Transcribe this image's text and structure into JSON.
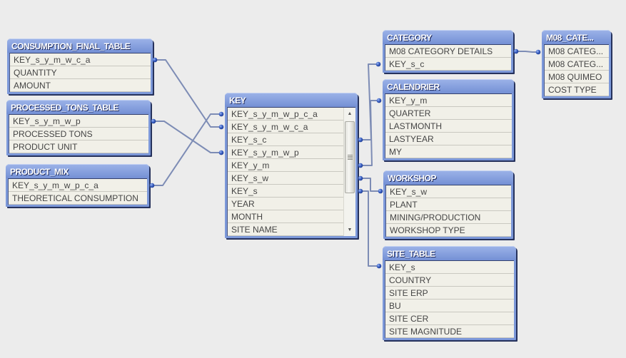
{
  "view": "Table Viewer - data model",
  "colors": {
    "background": "#ececec",
    "table_frame": "#7c98d9",
    "table_header_text": "#ffffff",
    "row_background": "#f1f0e8",
    "link_line": "#7d8cb5",
    "link_dot": "#2347a8"
  },
  "tables": [
    {
      "id": "consumption_final_table",
      "title": "CONSUMPTION_FINAL_TABLE",
      "fields": [
        "KEY_s_y_m_w_c_a",
        "QUANTITY",
        "AMOUNT"
      ]
    },
    {
      "id": "processed_tons_table",
      "title": "PROCESSED_TONS_TABLE",
      "fields": [
        "KEY_s_y_m_w_p",
        "PROCESSED TONS",
        "PRODUCT UNIT"
      ]
    },
    {
      "id": "product_mix",
      "title": "PRODUCT_MIX",
      "fields": [
        "KEY_s_y_m_w_p_c_a",
        "THEORETICAL CONSUMPTION"
      ]
    },
    {
      "id": "key",
      "title": "KEY",
      "fields": [
        "KEY_s_y_m_w_p_c_a",
        "KEY_s_y_m_w_c_a",
        "KEY_s_c",
        "KEY_s_y_m_w_p",
        "KEY_y_m",
        "KEY_s_w",
        "KEY_s",
        "YEAR",
        "MONTH",
        "SITE NAME"
      ],
      "scrollbar": {
        "position_fraction": 0.0,
        "visible_fraction": 0.69
      }
    },
    {
      "id": "category",
      "title": "CATEGORY",
      "fields": [
        "M08 CATEGORY DETAILS",
        "KEY_s_c"
      ]
    },
    {
      "id": "m08_category",
      "title": "M08_CATE...",
      "fields": [
        "M08 CATEG...",
        "M08 CATEG...",
        "M08 QUIMEO",
        "COST TYPE"
      ]
    },
    {
      "id": "calendrier",
      "title": "CALENDRIER",
      "fields": [
        "KEY_y_m",
        "QUARTER",
        "LASTMONTH",
        "LASTYEAR",
        "MY"
      ]
    },
    {
      "id": "workshop",
      "title": "WORKSHOP",
      "fields": [
        "KEY_s_w",
        "PLANT",
        "MINING/PRODUCTION",
        "WORKSHOP TYPE"
      ]
    },
    {
      "id": "site_table",
      "title": "SITE_TABLE",
      "fields": [
        "KEY_s",
        "COUNTRY",
        "SITE ERP",
        "BU",
        "SITE CER",
        "SITE MAGNITUDE"
      ]
    }
  ],
  "links": [
    {
      "from": "CONSUMPTION_FINAL_TABLE.KEY_s_y_m_w_c_a",
      "to": "KEY.KEY_s_y_m_w_c_a"
    },
    {
      "from": "PROCESSED_TONS_TABLE.KEY_s_y_m_w_p",
      "to": "KEY.KEY_s_y_m_w_p"
    },
    {
      "from": "PRODUCT_MIX.KEY_s_y_m_w_p_c_a",
      "to": "KEY.KEY_s_y_m_w_p_c_a"
    },
    {
      "from": "KEY.KEY_s_c",
      "to": "CATEGORY.KEY_s_c"
    },
    {
      "from": "KEY.KEY_y_m",
      "to": "CALENDRIER.KEY_y_m"
    },
    {
      "from": "KEY.KEY_s_w",
      "to": "WORKSHOP.KEY_s_w"
    },
    {
      "from": "KEY.KEY_s",
      "to": "SITE_TABLE.KEY_s"
    },
    {
      "from": "CATEGORY.M08 CATEGORY DETAILS",
      "to": "M08_CATE....M08 CATEG..."
    }
  ],
  "icons": {
    "scroll_up": "▲",
    "scroll_down": "▼"
  }
}
